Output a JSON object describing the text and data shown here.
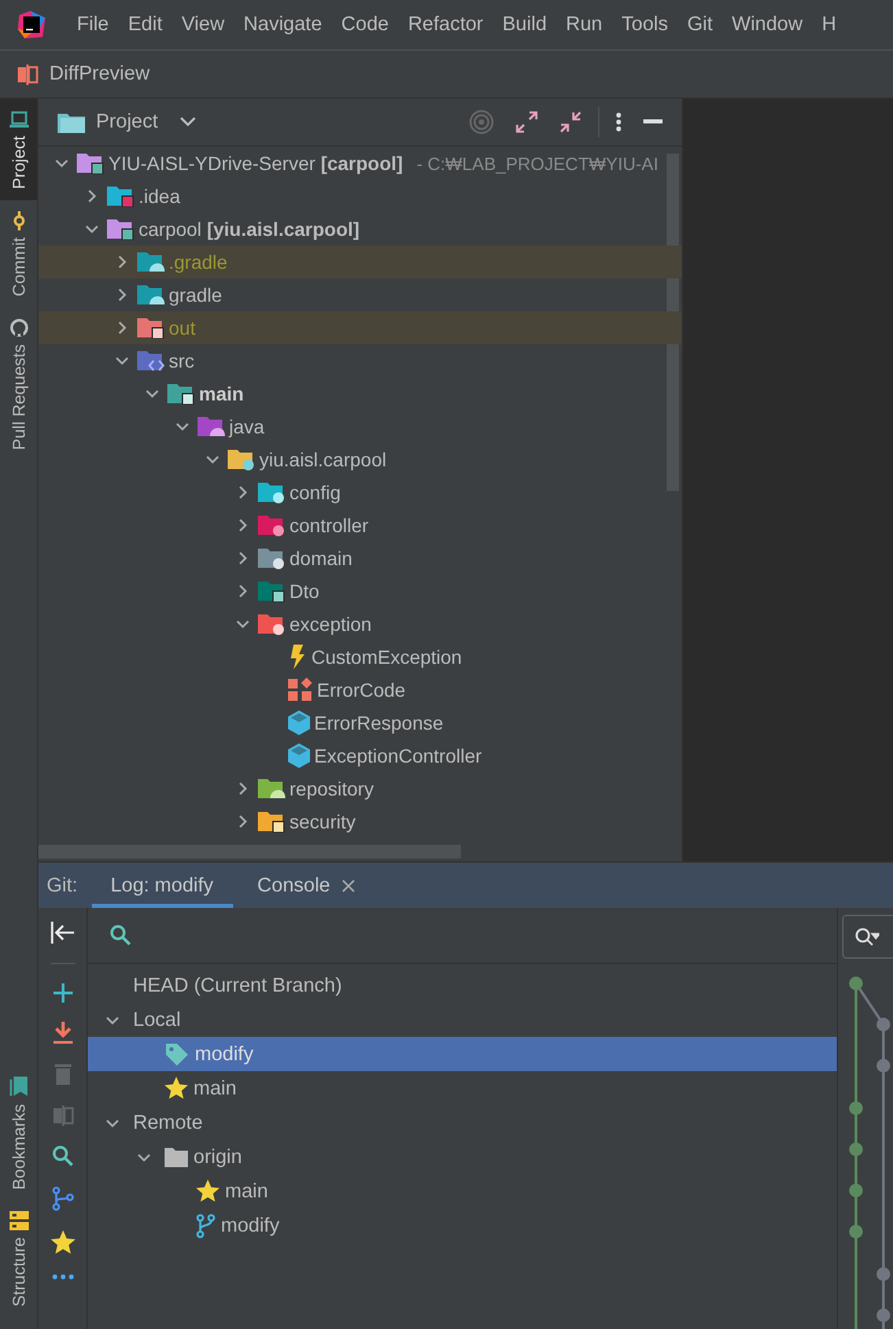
{
  "menu": [
    "File",
    "Edit",
    "View",
    "Navigate",
    "Code",
    "Refactor",
    "Build",
    "Run",
    "Tools",
    "Git",
    "Window",
    "H"
  ],
  "run_config": "DiffPreview",
  "left_stripe": {
    "top": [
      {
        "label": "Project",
        "selected": true,
        "kind": "laptop"
      },
      {
        "label": "Commit",
        "selected": false,
        "kind": "commit"
      },
      {
        "label": "Pull Requests",
        "selected": false,
        "kind": "github"
      }
    ],
    "bottom": [
      {
        "label": "Bookmarks",
        "selected": false,
        "kind": "bookmark"
      },
      {
        "label": "Structure",
        "selected": false,
        "kind": "structure"
      }
    ]
  },
  "project": {
    "title": "Project",
    "tree": [
      {
        "label": "YIU-AISL-YDrive-Server **[carpool]**",
        "path": "- C:₩LAB_PROJECT₩YIU-AI",
        "kind": "module",
        "expanded": true,
        "children": [
          {
            "label": ".idea",
            "kind": "idea",
            "expanded": false
          },
          {
            "label": "carpool **[yiu.aisl.carpool]**",
            "kind": "module",
            "expanded": true,
            "children": [
              {
                "label": ".gradle",
                "kind": "gradle",
                "expanded": false,
                "excluded": true
              },
              {
                "label": "gradle",
                "kind": "gradle",
                "expanded": false,
                "excluded": false
              },
              {
                "label": "out",
                "kind": "out",
                "expanded": false,
                "excluded": true
              },
              {
                "label": "src",
                "kind": "source",
                "expanded": true,
                "excluded": false,
                "children": [
                  {
                    "label": "main",
                    "bold": true,
                    "kind": "main",
                    "expanded": true,
                    "children": [
                      {
                        "label": "java",
                        "kind": "java",
                        "expanded": true,
                        "children": [
                          {
                            "label": "yiu.aisl.carpool",
                            "kind": "package",
                            "expanded": true,
                            "children": [
                              {
                                "label": "config",
                                "kind": "config",
                                "expanded": false
                              },
                              {
                                "label": "controller",
                                "kind": "controller",
                                "expanded": false
                              },
                              {
                                "label": "domain",
                                "kind": "domain",
                                "expanded": false
                              },
                              {
                                "label": "Dto",
                                "kind": "dto",
                                "expanded": false
                              },
                              {
                                "label": "exception",
                                "kind": "exception",
                                "expanded": true,
                                "children": [
                                  {
                                    "label": "CustomException",
                                    "kind": "exception-class"
                                  },
                                  {
                                    "label": "ErrorCode",
                                    "kind": "enum"
                                  },
                                  {
                                    "label": "ErrorResponse",
                                    "kind": "class"
                                  },
                                  {
                                    "label": "ExceptionController",
                                    "kind": "class"
                                  }
                                ]
                              },
                              {
                                "label": "repository",
                                "kind": "repository",
                                "expanded": false
                              },
                              {
                                "label": "security",
                                "kind": "security",
                                "expanded": false
                              }
                            ]
                          }
                        ]
                      }
                    ]
                  }
                ]
              }
            ]
          }
        ]
      }
    ]
  },
  "git": {
    "label": "Git:",
    "tabs": [
      {
        "label": "Log: modify",
        "selected": true,
        "closable": false
      },
      {
        "label": "Console",
        "selected": false,
        "closable": true
      }
    ],
    "toolbar": [
      {
        "disabled": false
      },
      {
        "disabled": false
      },
      {
        "disabled": false
      },
      {
        "disabled": true
      },
      {
        "disabled": true
      },
      {
        "disabled": false
      },
      {
        "disabled": false
      },
      {
        "disabled": false
      },
      {
        "disabled": false
      }
    ],
    "branches": [
      {
        "label": "HEAD (Current Branch)",
        "selected": false
      },
      {
        "label": "Local",
        "selected": false,
        "expanded": true,
        "children": [
          {
            "label": "modify",
            "kind": "tag",
            "selected": true
          },
          {
            "label": "main",
            "kind": "star",
            "selected": false
          }
        ]
      },
      {
        "label": "Remote",
        "selected": false,
        "expanded": true,
        "children": [
          {
            "label": "origin",
            "kind": "folder",
            "selected": false,
            "expanded": true,
            "children": [
              {
                "label": "main",
                "kind": "star",
                "selected": false
              },
              {
                "label": "modify",
                "kind": "branch",
                "selected": false
              }
            ]
          }
        ]
      }
    ]
  }
}
